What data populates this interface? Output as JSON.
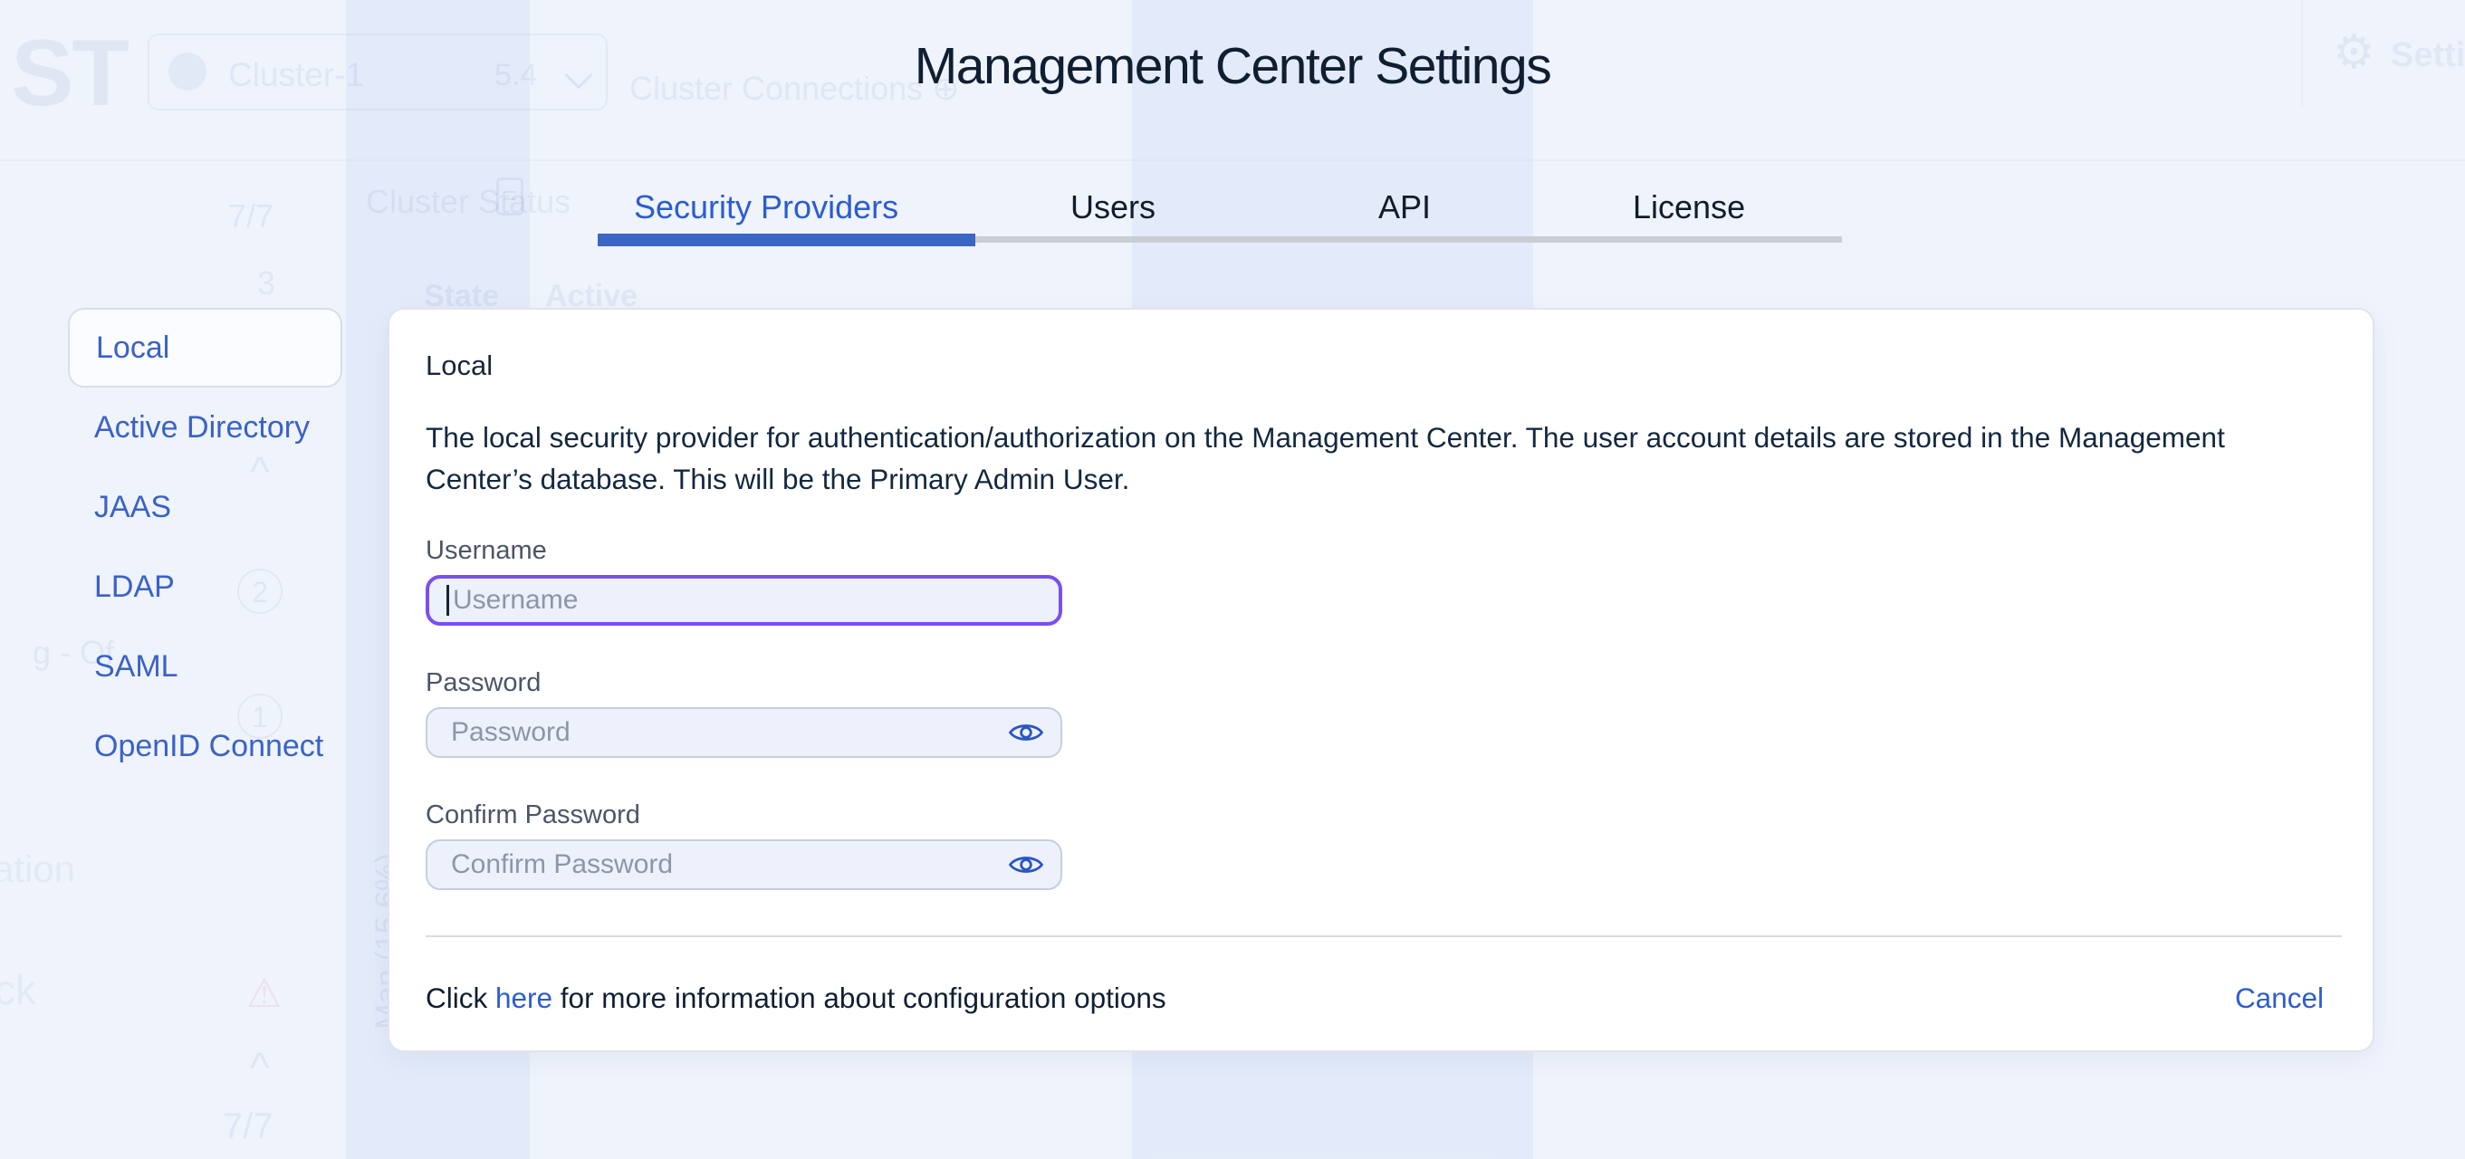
{
  "app": {
    "title": "Management Center Settings"
  },
  "tabs": [
    {
      "label": "Security Providers",
      "active": true
    },
    {
      "label": "Users",
      "active": false
    },
    {
      "label": "API",
      "active": false
    },
    {
      "label": "License",
      "active": false
    }
  ],
  "sidebar": {
    "items": [
      {
        "label": "Local",
        "active": true
      },
      {
        "label": "Active Directory",
        "active": false
      },
      {
        "label": "JAAS",
        "active": false
      },
      {
        "label": "LDAP",
        "active": false
      },
      {
        "label": "SAML",
        "active": false
      },
      {
        "label": "OpenID Connect",
        "active": false
      }
    ]
  },
  "panel": {
    "heading": "Local",
    "description": "The local security provider for authentication/authorization on the Management Center. The user account details are stored in the Management Center’s database. This will be the Primary Admin User.",
    "fields": [
      {
        "label": "Username",
        "placeholder": "Username",
        "value": "",
        "focused": true
      },
      {
        "label": "Password",
        "placeholder": "Password",
        "value": "",
        "focused": false
      },
      {
        "label": "Confirm Password",
        "placeholder": "Confirm Password",
        "value": "",
        "focused": false
      }
    ],
    "footer": {
      "pre": "Click ",
      "link_text": "here",
      "post": " for more information about configuration options",
      "cancel_label": "Cancel"
    }
  },
  "background": {
    "logo": "ST",
    "cluster_chip": {
      "name": "Cluster-1",
      "version": "5.4"
    },
    "cluster_connections": "Cluster Connections",
    "plus_glyph": "⊕",
    "gear_glyph": "⚙",
    "settings": "Settings",
    "cluster_status": "Cluster Status",
    "table_headers": {
      "state": "State",
      "active": "Active"
    },
    "counts": {
      "top": "7/7",
      "mid": "3",
      "badge_a": "2",
      "badge_b": "1",
      "bottom": "7/7"
    },
    "fragments": {
      "left_a": "ation",
      "left_b": "ck",
      "left_c": "g - Of",
      "map": "Map (15.6%)"
    },
    "warning_glyph": "⚠",
    "caret_up": "^"
  },
  "colors": {
    "accent_blue": "#2c5cd0",
    "focus_purple": "#7a4ff1",
    "title_navy": "#101e31",
    "page_bg": "#eff3fc",
    "card_bg": "#ffffff",
    "input_bg": "#edf1fc",
    "placeholder_gray": "#8e96a6",
    "active_underline": "#3a66c6",
    "divider_gray": "#d8dbe0"
  }
}
